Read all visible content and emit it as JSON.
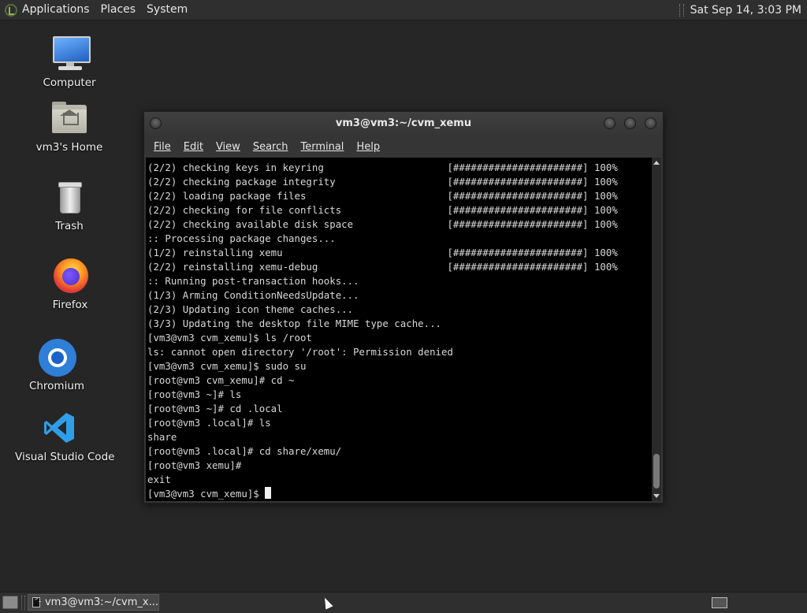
{
  "top_panel": {
    "menus": [
      "Applications",
      "Places",
      "System"
    ],
    "clock": "Sat Sep 14,  3:03 PM"
  },
  "desktop": {
    "icons": [
      {
        "label": "Computer",
        "icon": "computer-icon"
      },
      {
        "label": "vm3's Home",
        "icon": "home-folder-icon"
      },
      {
        "label": "Trash",
        "icon": "trash-icon"
      },
      {
        "label": "Firefox",
        "icon": "firefox-icon"
      },
      {
        "label": "Chromium",
        "icon": "chromium-icon"
      },
      {
        "label": "Visual Studio Code",
        "icon": "vscode-icon"
      }
    ]
  },
  "terminal": {
    "title": "vm3@vm3:~/cvm_xemu",
    "menu": [
      "File",
      "Edit",
      "View",
      "Search",
      "Terminal",
      "Help"
    ],
    "lines": [
      "(2/2) checking keys in keyring                     [######################] 100%",
      "(2/2) checking package integrity                   [######################] 100%",
      "(2/2) loading package files                        [######################] 100%",
      "(2/2) checking for file conflicts                  [######################] 100%",
      "(2/2) checking available disk space                [######################] 100%",
      ":: Processing package changes...",
      "(1/2) reinstalling xemu                            [######################] 100%",
      "(2/2) reinstalling xemu-debug                      [######################] 100%",
      ":: Running post-transaction hooks...",
      "(1/3) Arming ConditionNeedsUpdate...",
      "(2/3) Updating icon theme caches...",
      "(3/3) Updating the desktop file MIME type cache...",
      "[vm3@vm3 cvm_xemu]$ ls /root",
      "ls: cannot open directory '/root': Permission denied",
      "[vm3@vm3 cvm_xemu]$ sudo su",
      "[root@vm3 cvm_xemu]# cd ~",
      "[root@vm3 ~]# ls",
      "[root@vm3 ~]# cd .local",
      "[root@vm3 .local]# ls",
      "share",
      "[root@vm3 .local]# cd share/xemu/",
      "[root@vm3 xemu]#",
      "exit"
    ],
    "prompt": "[vm3@vm3 cvm_xemu]$ "
  },
  "bottom_panel": {
    "task_title": "vm3@vm3:~/cvm_x..."
  }
}
